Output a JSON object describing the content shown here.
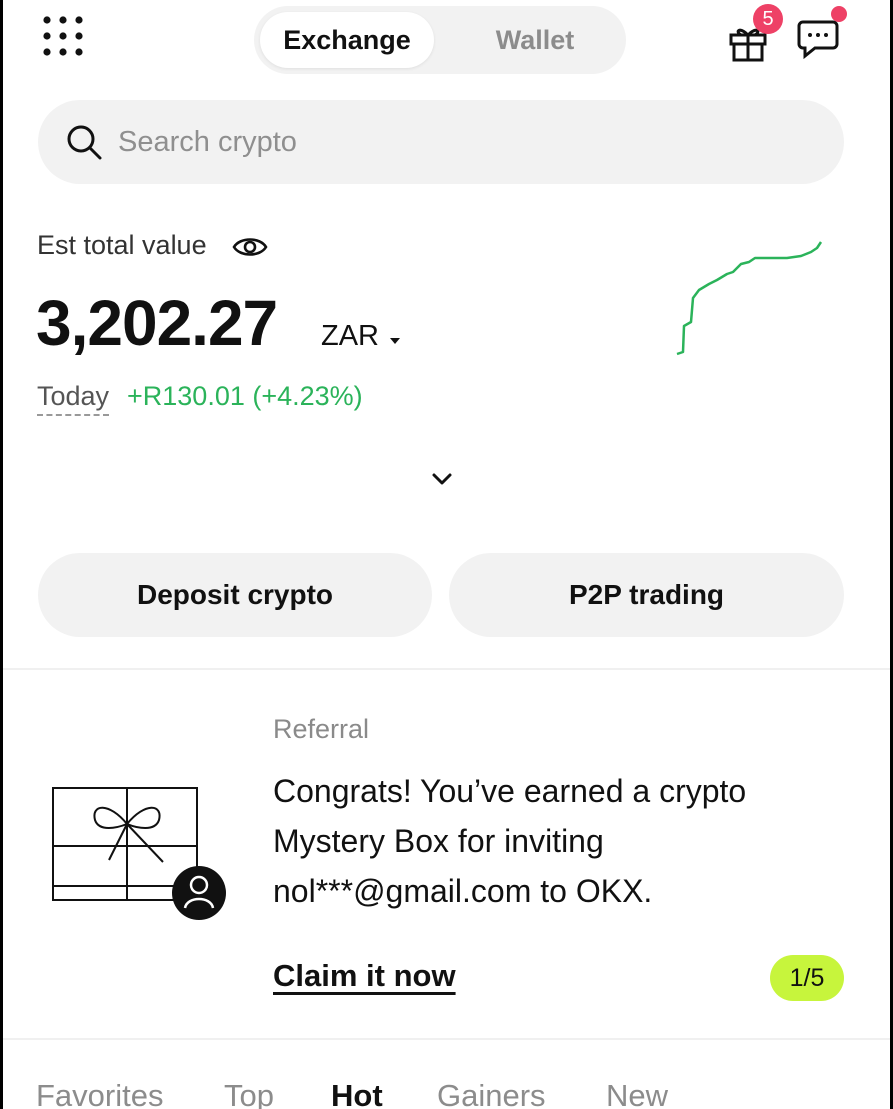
{
  "header": {
    "tabs": [
      {
        "label": "Exchange",
        "active": true
      },
      {
        "label": "Wallet",
        "active": false
      }
    ],
    "icons": {
      "menu": "grid-menu-icon",
      "gift": "gift-icon",
      "chat": "chat-icon"
    },
    "gift_badge_count": "5",
    "badge_color": "#ee4166"
  },
  "search": {
    "placeholder": "Search crypto"
  },
  "balance": {
    "label": "Est total value",
    "value": "3,202.27",
    "currency": "ZAR",
    "today_label": "Today",
    "today_change": "+R130.01 (+4.23%)",
    "change_color": "#2bb35a"
  },
  "actions": {
    "deposit": "Deposit crypto",
    "p2p": "P2P trading"
  },
  "referral": {
    "label": "Referral",
    "message_lines": [
      "Congrats! You’ve earned a crypto",
      "Mystery Box for inviting",
      "nol***@gmail.com to OKX."
    ],
    "claim": "Claim it now",
    "pager": "1/5",
    "pager_color": "#c7f53c"
  },
  "market_tabs": [
    {
      "label": "Favorites",
      "active": false
    },
    {
      "label": "Top",
      "active": false
    },
    {
      "label": "Hot",
      "active": true
    },
    {
      "label": "Gainers",
      "active": false
    },
    {
      "label": "New",
      "active": false
    }
  ]
}
